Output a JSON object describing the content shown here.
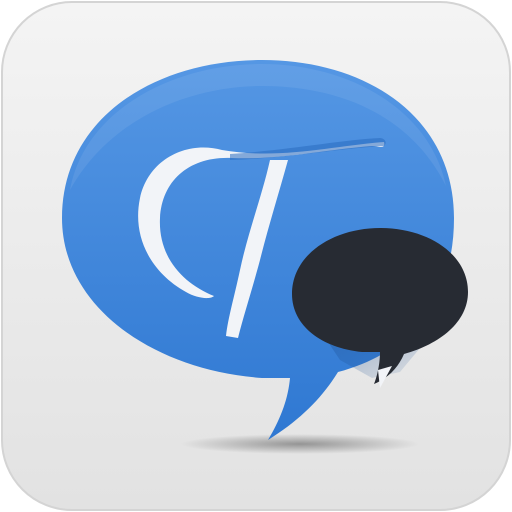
{
  "icon": {
    "name": "chat-speech-bubbles-app-icon",
    "glyph": "T",
    "colors": {
      "tile": "#ececec",
      "tile_edge": "#d6d6d6",
      "bubble_blue": "#3f86dc",
      "bubble_blue_light": "#5d9de6",
      "bubble_dark": "#272b33",
      "letter": "#f2f4f8"
    }
  }
}
